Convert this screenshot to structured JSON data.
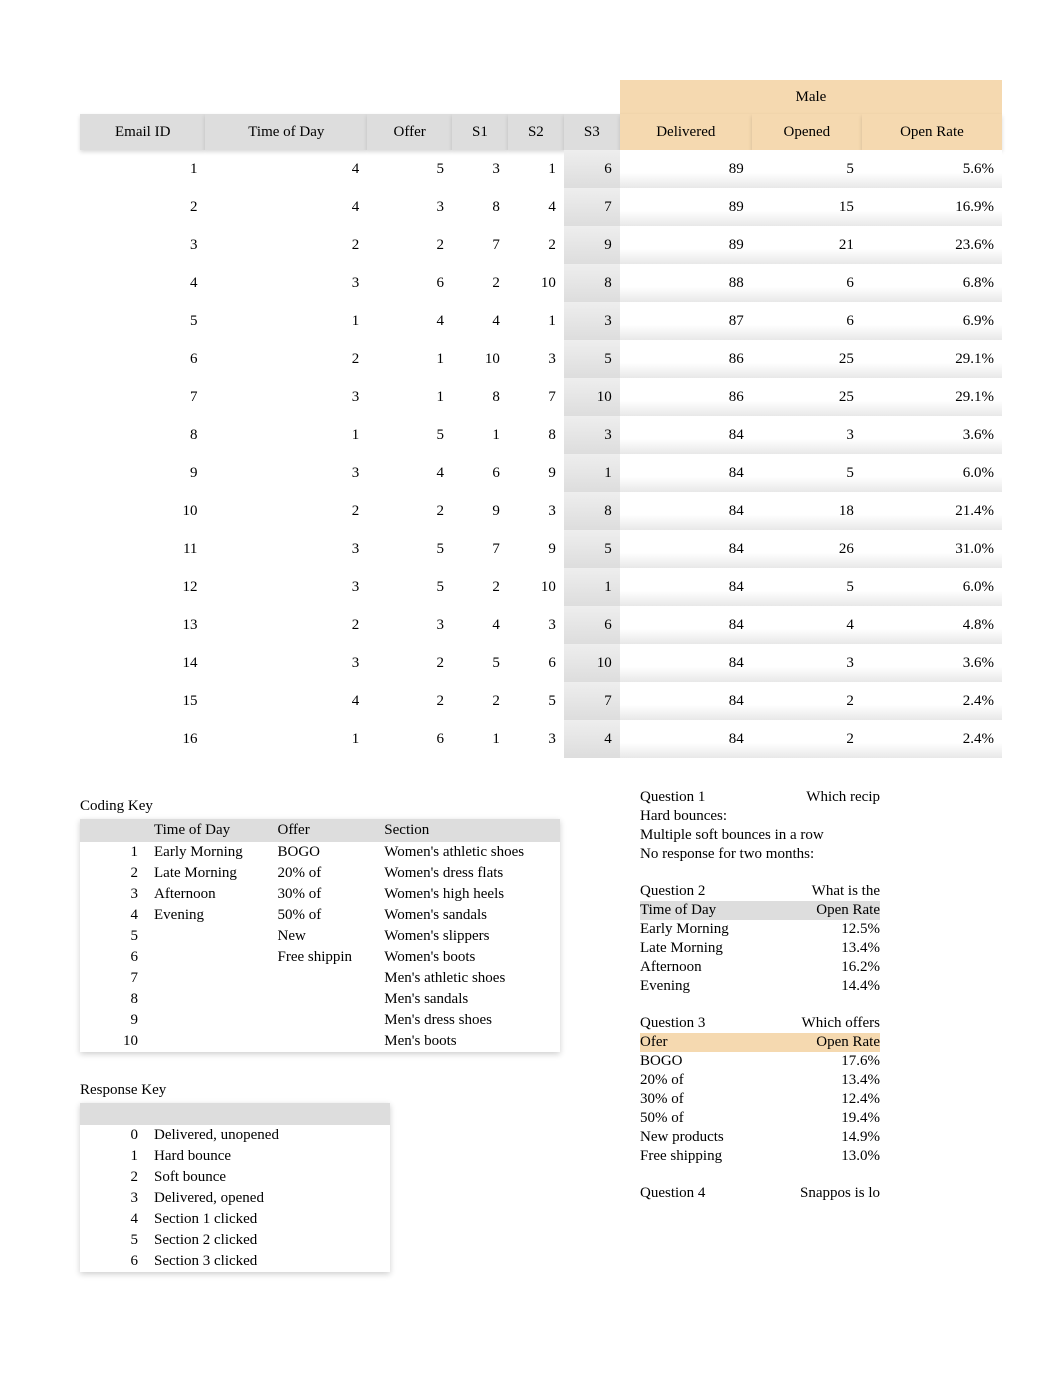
{
  "main": {
    "group_header_male": "Male",
    "headers": [
      "Email ID",
      "Time of Day",
      "Offer",
      "S1",
      "S2",
      "S3",
      "Delivered",
      "Opened",
      "Open Rate"
    ],
    "rows": [
      [
        "1",
        "4",
        "5",
        "3",
        "1",
        "6",
        "89",
        "5",
        "5.6%"
      ],
      [
        "2",
        "4",
        "3",
        "8",
        "4",
        "7",
        "89",
        "15",
        "16.9%"
      ],
      [
        "3",
        "2",
        "2",
        "7",
        "2",
        "9",
        "89",
        "21",
        "23.6%"
      ],
      [
        "4",
        "3",
        "6",
        "2",
        "10",
        "8",
        "88",
        "6",
        "6.8%"
      ],
      [
        "5",
        "1",
        "4",
        "4",
        "1",
        "3",
        "87",
        "6",
        "6.9%"
      ],
      [
        "6",
        "2",
        "1",
        "10",
        "3",
        "5",
        "86",
        "25",
        "29.1%"
      ],
      [
        "7",
        "3",
        "1",
        "8",
        "7",
        "10",
        "86",
        "25",
        "29.1%"
      ],
      [
        "8",
        "1",
        "5",
        "1",
        "8",
        "3",
        "84",
        "3",
        "3.6%"
      ],
      [
        "9",
        "3",
        "4",
        "6",
        "9",
        "1",
        "84",
        "5",
        "6.0%"
      ],
      [
        "10",
        "2",
        "2",
        "9",
        "3",
        "8",
        "84",
        "18",
        "21.4%"
      ],
      [
        "11",
        "3",
        "5",
        "7",
        "9",
        "5",
        "84",
        "26",
        "31.0%"
      ],
      [
        "12",
        "3",
        "5",
        "2",
        "10",
        "1",
        "84",
        "5",
        "6.0%"
      ],
      [
        "13",
        "2",
        "3",
        "4",
        "3",
        "6",
        "84",
        "4",
        "4.8%"
      ],
      [
        "14",
        "3",
        "2",
        "5",
        "6",
        "10",
        "84",
        "3",
        "3.6%"
      ],
      [
        "15",
        "4",
        "2",
        "2",
        "5",
        "7",
        "84",
        "2",
        "2.4%"
      ],
      [
        "16",
        "1",
        "6",
        "1",
        "3",
        "4",
        "84",
        "2",
        "2.4%"
      ]
    ]
  },
  "coding_key": {
    "title": "Coding Key",
    "headers": [
      "",
      "Time of Day",
      "Offer",
      "Section"
    ],
    "rows": [
      [
        "1",
        "Early Morning",
        "BOGO",
        "Women's athletic shoes"
      ],
      [
        "2",
        "Late Morning",
        "20% of",
        "Women's dress flats"
      ],
      [
        "3",
        "Afternoon",
        "30% of",
        "Women's high heels"
      ],
      [
        "4",
        "Evening",
        "50% of",
        "Women's sandals"
      ],
      [
        "5",
        "",
        "New",
        "Women's slippers"
      ],
      [
        "6",
        "",
        "Free shippin",
        "Women's boots"
      ],
      [
        "7",
        "",
        "",
        "Men's athletic shoes"
      ],
      [
        "8",
        "",
        "",
        "Men's sandals"
      ],
      [
        "9",
        "",
        "",
        "Men's dress shoes"
      ],
      [
        "10",
        "",
        "",
        "Men's boots"
      ]
    ]
  },
  "response_key": {
    "title": "Response Key",
    "rows": [
      [
        "0",
        "Delivered, unopened"
      ],
      [
        "1",
        "Hard bounce"
      ],
      [
        "2",
        "Soft bounce"
      ],
      [
        "3",
        "Delivered, opened"
      ],
      [
        "4",
        "Section 1 clicked"
      ],
      [
        "5",
        "Section 2 clicked"
      ],
      [
        "6",
        "Section 3 clicked"
      ]
    ]
  },
  "questions": {
    "q1": {
      "title_l": "Question 1",
      "title_r": "Which recip",
      "lines": [
        "Hard bounces:",
        "Multiple soft bounces in a row",
        "No response for two months:"
      ]
    },
    "q2": {
      "title_l": "Question 2",
      "title_r": "What is the",
      "header_l": "Time of Day",
      "header_r": "Open Rate",
      "rows": [
        [
          "Early Morning",
          "12.5%"
        ],
        [
          "Late Morning",
          "13.4%"
        ],
        [
          "Afternoon",
          "16.2%"
        ],
        [
          "Evening",
          "14.4%"
        ]
      ]
    },
    "q3": {
      "title_l": "Question 3",
      "title_r": "Which offers",
      "header_l": "Ofer",
      "header_r": "Open Rate",
      "rows": [
        [
          "BOGO",
          "17.6%"
        ],
        [
          "20% of",
          "13.4%"
        ],
        [
          "30% of",
          "12.4%"
        ],
        [
          "50% of",
          "19.4%"
        ],
        [
          "New products",
          "14.9%"
        ],
        [
          "Free shipping",
          "13.0%"
        ]
      ]
    },
    "q4": {
      "title_l": "Question 4",
      "title_r": "Snappos is lo"
    }
  }
}
